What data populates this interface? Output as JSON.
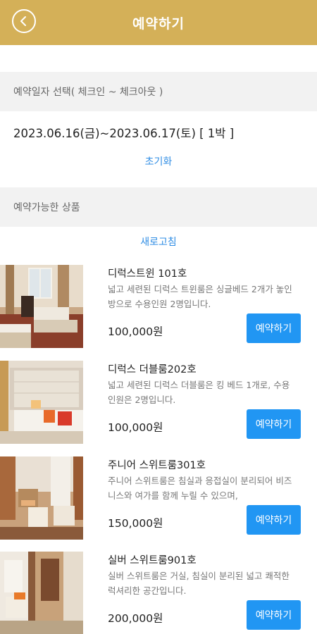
{
  "header": {
    "title": "예약하기",
    "back_icon": "chevron-left-icon",
    "bg_color": "#d4b058"
  },
  "date_section": {
    "label": "예약일자 선택( 체크인 ~ 체크아웃 )",
    "selected_range": "2023.06.16(금)~2023.06.17(토) [ 1박 ]",
    "reset_label": "초기화"
  },
  "products_section": {
    "label": "예약가능한 상품",
    "refresh_label": "새로고침"
  },
  "rooms": [
    {
      "name": "디럭스트윈 101호",
      "description": "넓고 세련된 디럭스 트윈룸은 싱글베드 2개가 놓인방으로 수용인원 2명입니다.",
      "price": "100,000원",
      "button": "예약하기"
    },
    {
      "name": "디럭스 더블룸202호",
      "description": "넓고 세련된 디럭스 더블룸은 킹 베드 1개로, 수용인원은 2명입니다.",
      "price": "100,000원",
      "button": "예약하기"
    },
    {
      "name": "주니어 스위트룸301호",
      "description": "주니어 스위트룸은 침실과 응접실이 분리되어 비즈니스와 여가를 함께 누릴 수 있으며,",
      "price": "150,000원",
      "button": "예약하기"
    },
    {
      "name": "실버 스위트룸901호",
      "description": "실버 스위트룸은 거실, 침실이 분리된 넓고 쾌적한 럭셔리한 공간입니다.",
      "price": "200,000원",
      "button": "예약하기"
    }
  ],
  "accent_color": "#2196f3"
}
